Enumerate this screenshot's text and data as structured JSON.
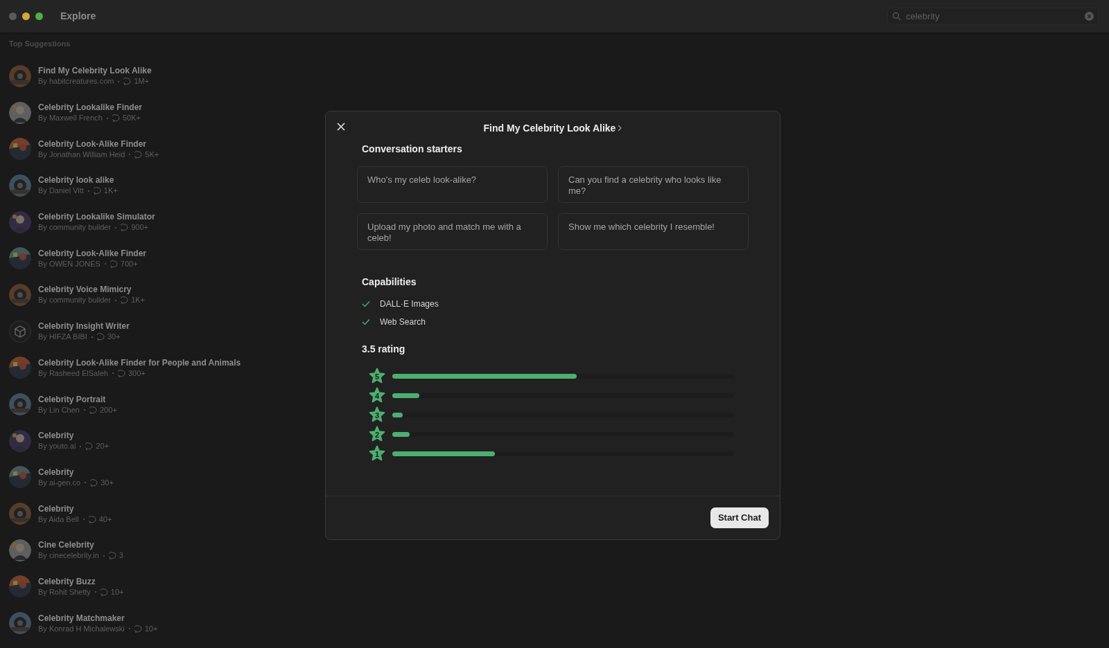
{
  "window": {
    "title": "Explore"
  },
  "search": {
    "value": "celebrity"
  },
  "list": {
    "heading": "Top Suggestions",
    "items": [
      {
        "title": "Find My Celebrity Look Alike",
        "author": "By habitcreatures.com",
        "count": "1M+",
        "kind": "picture"
      },
      {
        "title": "Celebrity Lookalike Finder",
        "author": "By Maxwell French",
        "count": "50K+",
        "kind": "picture"
      },
      {
        "title": "Celebrity Look-Alike Finder",
        "author": "By Jonathan William Heid",
        "count": "5K+",
        "kind": "picture"
      },
      {
        "title": "Celebrity look alike",
        "author": "By Daniel Vitt",
        "count": "1K+",
        "kind": "picture"
      },
      {
        "title": "Celebrity Lookalike Simulator",
        "author": "By community builder",
        "count": "900+",
        "kind": "picture"
      },
      {
        "title": "Celebrity Look-Alike Finder",
        "author": "By OWEN JONES",
        "count": "700+",
        "kind": "picture"
      },
      {
        "title": "Celebrity Voice Mimicry",
        "author": "By community builder",
        "count": "1K+",
        "kind": "picture"
      },
      {
        "title": "Celebrity Insight Writer",
        "author": "By HIFZA BIBI",
        "count": "30+",
        "kind": "cube"
      },
      {
        "title": "Celebrity Look-Alike Finder for People and Animals",
        "author": "By Rasheed ElSaleh",
        "count": "300+",
        "kind": "picture"
      },
      {
        "title": "Celebrity Portrait",
        "author": "By Lin Chen",
        "count": "200+",
        "kind": "picture"
      },
      {
        "title": "Celebrity",
        "author": "By youto.ai",
        "count": "20+",
        "kind": "picture"
      },
      {
        "title": "Celebrity",
        "author": "By ai-gen.co",
        "count": "30+",
        "kind": "picture"
      },
      {
        "title": "Celebrity",
        "author": "By Aida Bell",
        "count": "40+",
        "kind": "picture"
      },
      {
        "title": "Cine Celebrity",
        "author": "By cinecelebrity.in",
        "count": "3",
        "kind": "picture"
      },
      {
        "title": "Celebrity Buzz",
        "author": "By Rohit Shetty",
        "count": "10+",
        "kind": "picture"
      },
      {
        "title": "Celebrity Matchmaker",
        "author": "By Konrad H Michalewski",
        "count": "10+",
        "kind": "picture"
      }
    ]
  },
  "dialog": {
    "title": "Find My Celebrity Look Alike",
    "starters_heading": "Conversation starters",
    "starters": [
      "Who's my celeb look-alike?",
      "Can you find a celebrity who looks like me?",
      "Upload my photo and match me with a celeb!",
      "Show me which celebrity I resemble!"
    ],
    "capabilities_heading": "Capabilities",
    "capabilities": [
      "DALL·E Images",
      "Web Search"
    ],
    "rating_heading": "3.5 rating",
    "ratings": [
      {
        "label": "5",
        "level": 0.54
      },
      {
        "label": "4",
        "level": 0.08
      },
      {
        "label": "3",
        "level": 0.03
      },
      {
        "label": "2",
        "level": 0.05
      },
      {
        "label": "1",
        "level": 0.3
      }
    ],
    "button": "Start Chat"
  }
}
